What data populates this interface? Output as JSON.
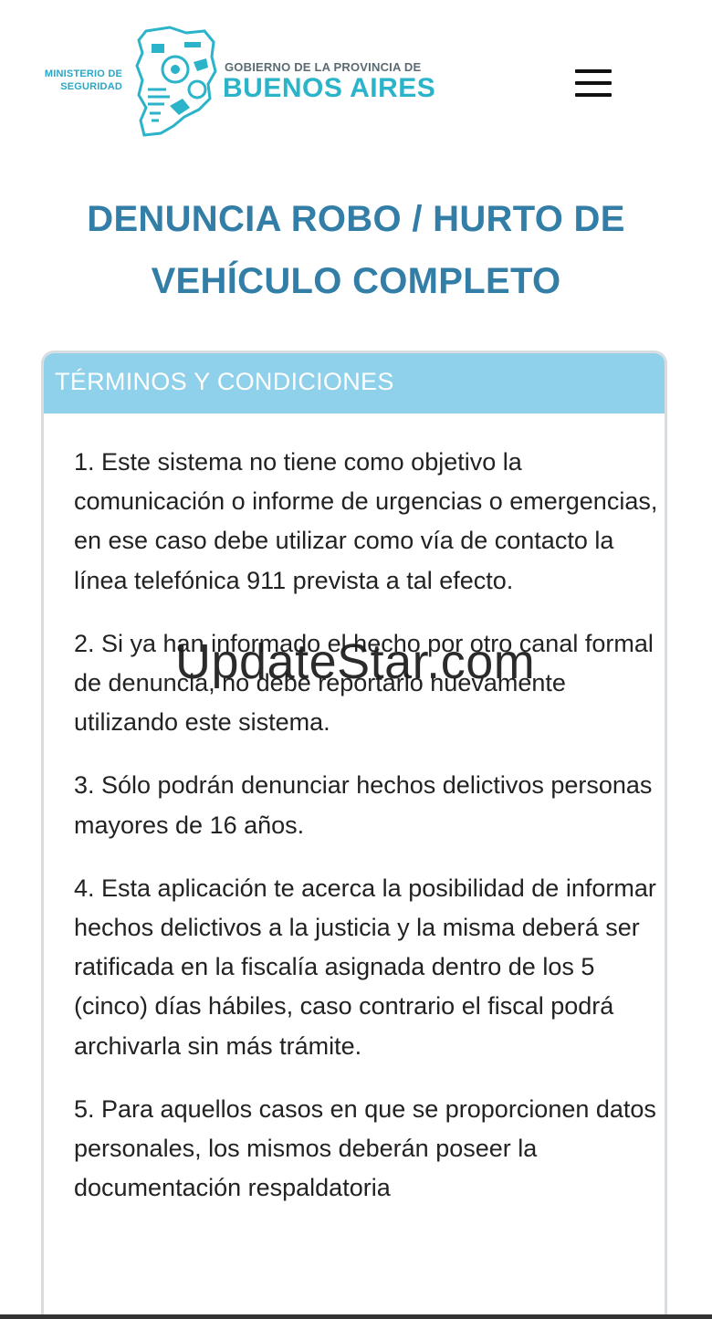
{
  "header": {
    "ministry_line1": "MINISTERIO DE",
    "ministry_line2": "SEGURIDAD",
    "gov_line1": "GOBIERNO DE LA PROVINCIA DE",
    "gov_line2": "BUENOS AIRES",
    "menu_icon": "hamburger-menu-icon",
    "brand_color": "#2ab3c9"
  },
  "page": {
    "title_line1": "DENUNCIA ROBO / HURTO DE",
    "title_line2": "VEHÍCULO COMPLETO",
    "title_color": "#337ea6"
  },
  "terms": {
    "header_label": "TÉRMINOS Y CONDICIONES",
    "header_color": "#8fd0ea",
    "items": [
      "1. Este sistema no tiene como objetivo la comunicación o informe de urgencias o emergencias, en ese caso debe utilizar como vía de contacto la línea telefónica 911 prevista a tal efecto.",
      "2. Si ya han informado el hecho por otro canal formal de denuncia, no debe reportarlo nuevamente utilizando este sistema.",
      "3. Sólo podrán denunciar hechos delictivos personas mayores de 16 años.",
      "4. Esta aplicación te acerca la posibilidad de informar hechos delictivos a la justicia y la misma deberá ser ratificada en la fiscalía asignada dentro de los 5 (cinco) días hábiles, caso contrario el fiscal podrá archivarla sin más trámite.",
      "5. Para aquellos casos en que se proporcionen datos personales, los mismos deberán poseer la documentación respaldatoria"
    ]
  },
  "watermark": "UpdateStar.com"
}
